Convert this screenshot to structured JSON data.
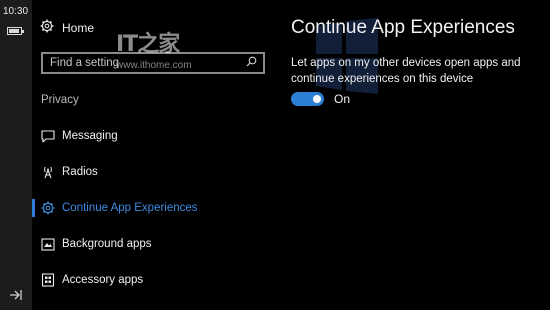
{
  "status": {
    "time": "10:30",
    "battery_icon": "battery-icon",
    "nav_icon": "navigation-arrow-icon"
  },
  "nav": {
    "home": {
      "label": "Home",
      "icon": "gear-icon"
    },
    "search": {
      "placeholder": "Find a setting",
      "icon": "search-icon"
    },
    "section_title": "Privacy",
    "items": [
      {
        "label": "Messaging",
        "icon": "message-icon",
        "selected": false
      },
      {
        "label": "Radios",
        "icon": "radio-tower-icon",
        "selected": false
      },
      {
        "label": "Continue App Experiences",
        "icon": "gear-icon",
        "selected": true
      },
      {
        "label": "Background apps",
        "icon": "background-apps-icon",
        "selected": false
      },
      {
        "label": "Accessory apps",
        "icon": "accessory-apps-icon",
        "selected": false
      }
    ]
  },
  "content": {
    "title": "Continue App Experiences",
    "description": "Let apps on my other devices open apps and continue experiences on this device",
    "toggle": {
      "label": "On",
      "state": true
    }
  },
  "watermark": {
    "logo": "IT之家",
    "url": "www.ithome.com"
  },
  "colors": {
    "accent": "#2d7fd6",
    "selected_text": "#3d8be0",
    "background": "#000000",
    "status_strip": "#1c1c1c"
  }
}
